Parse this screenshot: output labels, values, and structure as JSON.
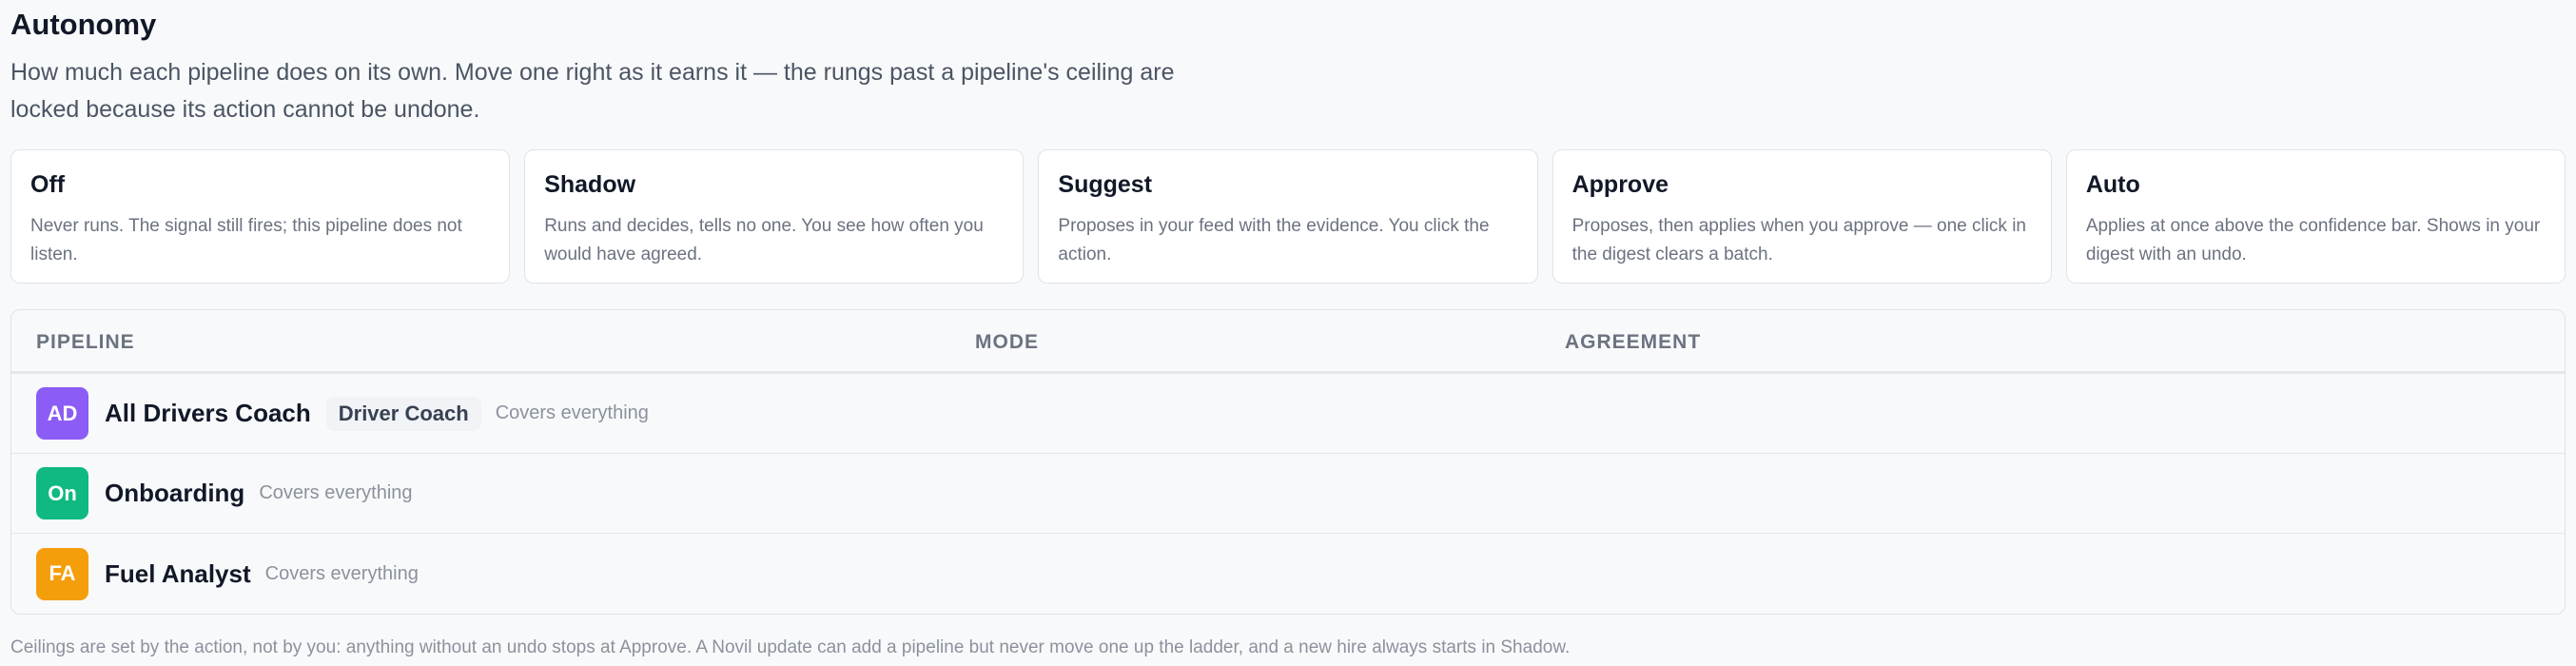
{
  "header": {
    "title": "Autonomy",
    "subtitle": "How much each pipeline does on its own. Move one right as it earns it — the rungs past a pipeline's ceiling are locked because its action cannot be undone."
  },
  "modes": [
    {
      "title": "Off",
      "description": "Never runs. The signal still fires; this pipeline does not listen."
    },
    {
      "title": "Shadow",
      "description": "Runs and decides, tells no one. You see how often you would have agreed."
    },
    {
      "title": "Suggest",
      "description": "Proposes in your feed with the evidence. You click the action."
    },
    {
      "title": "Approve",
      "description": "Proposes, then applies when you approve — one click in the digest clears a batch."
    },
    {
      "title": "Auto",
      "description": "Applies at once above the confidence bar. Shows in your digest with an undo."
    }
  ],
  "table": {
    "columns": {
      "pipeline": "PIPELINE",
      "mode": "MODE",
      "agreement": "AGREEMENT"
    },
    "rows": [
      {
        "initials": "AD",
        "name": "All Drivers Coach",
        "tag": "Driver Coach",
        "coverage": "Covers everything",
        "color": "#8b5cf6"
      },
      {
        "initials": "On",
        "name": "Onboarding",
        "tag": "",
        "coverage": "Covers everything",
        "color": "#10b981"
      },
      {
        "initials": "FA",
        "name": "Fuel Analyst",
        "tag": "",
        "coverage": "Covers everything",
        "color": "#f59e0b"
      }
    ]
  },
  "footnote": "Ceilings are set by the action, not by you: anything without an undo stops at Approve. A Novil update can add a pipeline but never move one up the ladder, and a new hire always starts in Shadow."
}
